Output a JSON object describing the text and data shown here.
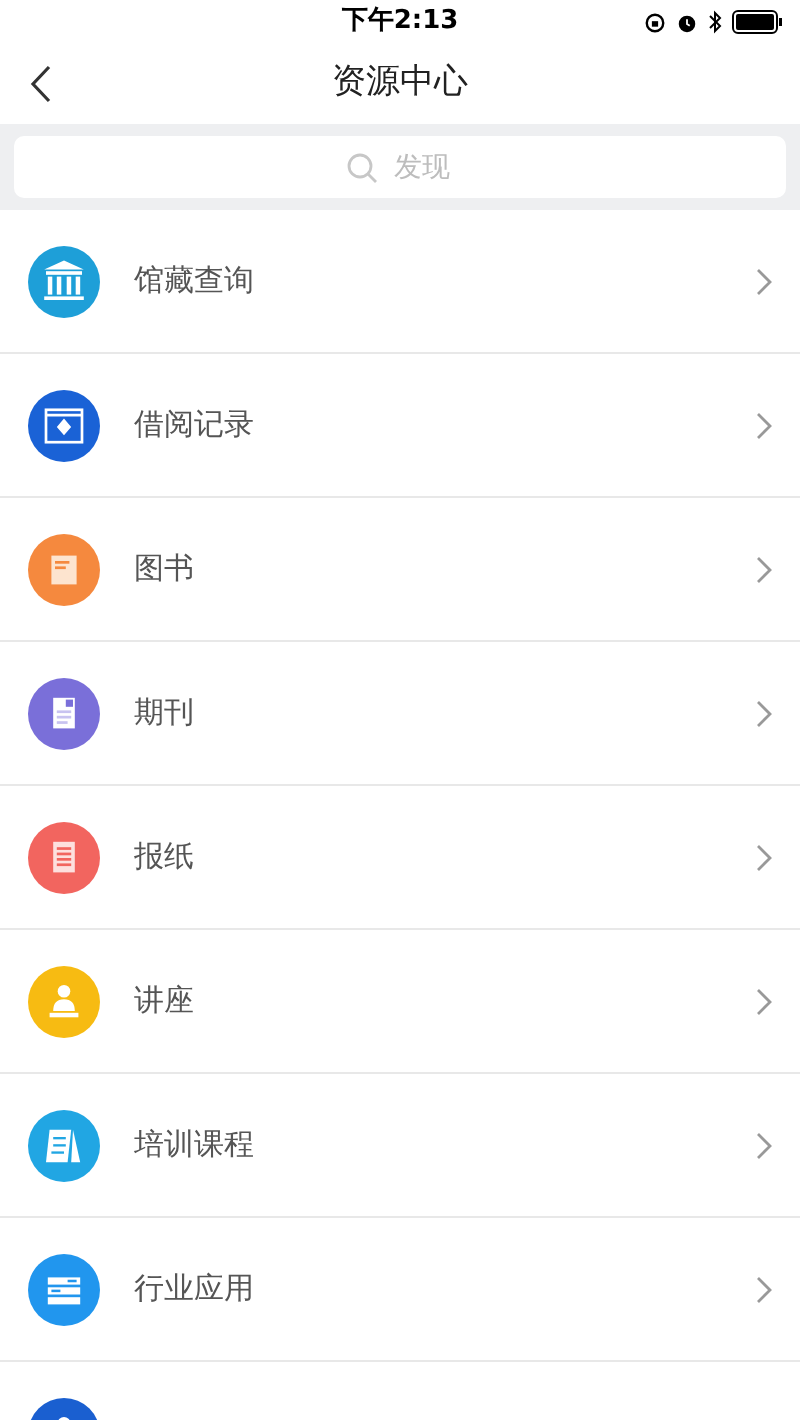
{
  "status_bar": {
    "time": "下午2:13"
  },
  "nav": {
    "title": "资源中心"
  },
  "search": {
    "placeholder": "发现"
  },
  "items": [
    {
      "label": "馆藏查询",
      "kind": "library",
      "color": "#1e9fd8"
    },
    {
      "label": "借阅记录",
      "kind": "window",
      "color": "#1a62d6"
    },
    {
      "label": "图书",
      "kind": "book",
      "color": "#f5893e"
    },
    {
      "label": "期刊",
      "kind": "journal",
      "color": "#7a6fd9"
    },
    {
      "label": "报纸",
      "kind": "newspaper",
      "color": "#f2655f"
    },
    {
      "label": "讲座",
      "kind": "person",
      "color": "#f7bb12"
    },
    {
      "label": "培训课程",
      "kind": "notebook",
      "color": "#21a6e3"
    },
    {
      "label": "行业应用",
      "kind": "list",
      "color": "#2196ee"
    },
    {
      "kind": "person",
      "color": "#1a5fd0"
    }
  ]
}
